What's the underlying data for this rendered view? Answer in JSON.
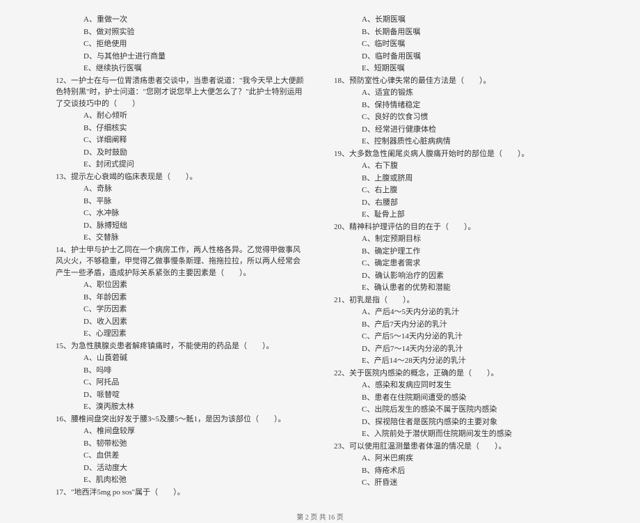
{
  "leftColumn": {
    "q11options": [
      "A、重做一次",
      "B、做对照实验",
      "C、拒绝使用",
      "D、与其他护士进行商量",
      "E、继续执行医嘱"
    ],
    "q12": "12、一护士在与一位胃溃疡患者交谈中，当患者说道：\"我今天早上大便颜色特别黑\"时，护士问道：\"您刚才说您早上大便怎么了？\"此护士特别运用了交谈技巧中的（　　）",
    "q12options": [
      "A、耐心倾听",
      "B、仔细核实",
      "C、详细阐释",
      "D、及时鼓励",
      "E、封闭式提问"
    ],
    "q13": "13、提示左心衰竭的临床表现是（　　）。",
    "q13options": [
      "A、奇脉",
      "B、平脉",
      "C、水冲脉",
      "D、脉搏短绌",
      "E、交替脉"
    ],
    "q14": "14、护士甲与护士乙同在一个病房工作，两人性格各异。乙觉得甲做事风风火火，不够稳重，甲觉得乙做事慢条斯理、拖拖拉拉，所以两人经常会产生一些矛盾，造成护际关系紧张的主要因素是（　　）。",
    "q14options": [
      "A、职位因素",
      "B、年龄因素",
      "C、学历因素",
      "D、收入因素",
      "E、心理因素"
    ],
    "q15": "15、为急性胰腺炎患者解疼镇痛时，不能使用的药品是（　　）。",
    "q15options": [
      "A、山莨菪碱",
      "B、吗啡",
      "C、阿托品",
      "D、哌替啶",
      "E、溴丙胺太林"
    ],
    "q16": "16、腰椎间盘突出好发于腰3~5及腰5～骶1，是因为该部位（　　）。",
    "q16options": [
      "A、椎间盘较厚",
      "B、韧带松弛",
      "C、血供差",
      "D、活动度大",
      "E、肌肉松弛"
    ],
    "q17": "17、\"地西泮5mg po sos\"属于（　　）。"
  },
  "rightColumn": {
    "q17options": [
      "A、长期医嘱",
      "B、长期备用医嘱",
      "C、临时医嘱",
      "D、临时备用医嘱",
      "E、短期医嘱"
    ],
    "q18": "18、预防室性心律失常的最佳方法是（　　）。",
    "q18options": [
      "A、适宜的锻炼",
      "B、保持情绪稳定",
      "C、良好的饮食习惯",
      "D、经常进行健康体检",
      "E、控制器质性心脏病病情"
    ],
    "q19": "19、大多数急性阑尾炎病人腹痛开始时的部位是（　　）。",
    "q19options": [
      "A、右下腹",
      "B、上腹或脐周",
      "C、右上腹",
      "D、右腰部",
      "E、耻骨上部"
    ],
    "q20": "20、精神科护理评估的目的在于（　　）。",
    "q20options": [
      "A、制定预期目标",
      "B、确定护理工作",
      "C、确定患者需求",
      "D、确认影响治疗的因素",
      "E、确认患者的优势和潜能"
    ],
    "q21": "21、初乳是指（　　）。",
    "q21options": [
      "A、产后4～5天内分泌的乳汁",
      "B、产后7天内分泌的乳汁",
      "C、产后5～14天内分泌的乳汁",
      "D、产后7～14天内分泌的乳汁",
      "E、产后14～28天内分泌的乳汁"
    ],
    "q22": "22、关于医院内感染的概念，正确的是（　　）。",
    "q22options": [
      "A、感染和发病应同时发生",
      "B、患者在住院期间遭受的感染",
      "C、出院后发生的感染不属于医院内感染",
      "D、探视陪住者是医院内感染的主要对象",
      "E、入院前处于潜伏期而住院期间发生的感染"
    ],
    "q23": "23、可以使用肛温测量患者体温的情况是（　　）。",
    "q23options": [
      "A、阿米巴痢疾",
      "B、痔疮术后",
      "C、肝昏迷"
    ]
  },
  "footer": "第 2 页 共 16 页"
}
